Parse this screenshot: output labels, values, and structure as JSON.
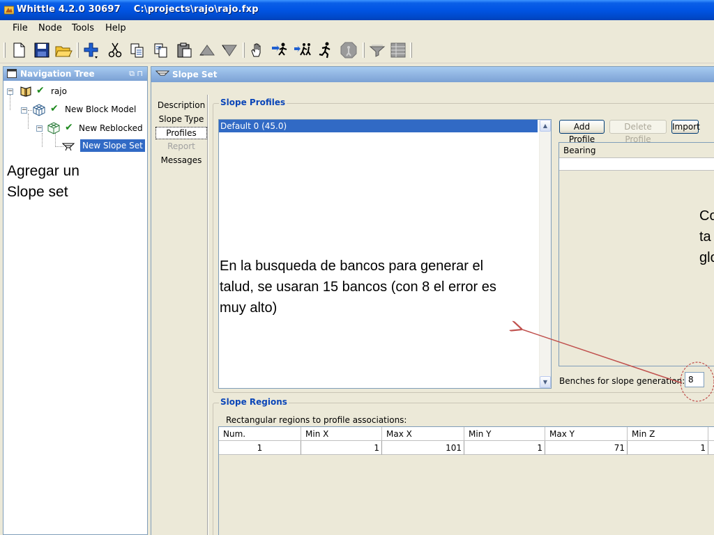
{
  "window": {
    "title": "Whittle 4.2.0 30697    C:\\projects\\rajo\\rajo.fxp"
  },
  "menu": [
    "File",
    "Node",
    "Tools",
    "Help"
  ],
  "toolbar": {
    "buttons": [
      "new-file-icon",
      "save-icon",
      "open-folder-icon",
      "add-node-icon",
      "cut-icon",
      "copy-icon",
      "paste-icon",
      "paste-special-icon",
      "pit-shell-icon",
      "inverted-pit-icon",
      "hand-pan-icon",
      "run-forward-icon",
      "run-multiple-icon",
      "runner-icon",
      "stop-icon",
      "filter-icon",
      "report-table-icon"
    ]
  },
  "nav": {
    "title": "Navigation Tree",
    "controls": "⧉ ⊓",
    "tree": [
      {
        "label": "rajo",
        "level": 0
      },
      {
        "label": "New Block Model",
        "level": 1
      },
      {
        "label": "New Reblocked",
        "level": 2
      },
      {
        "label": "New Slope Set",
        "level": 3,
        "selected": true
      }
    ],
    "annotation_line1": "Agregar un",
    "annotation_line2": "Slope set"
  },
  "slope_set": {
    "title": "Slope Set",
    "tabs": [
      {
        "label": "Description",
        "state": "normal"
      },
      {
        "label": "Slope Type",
        "state": "normal"
      },
      {
        "label": "Profiles",
        "state": "active"
      },
      {
        "label": "Report",
        "state": "disabled"
      },
      {
        "label": "Messages",
        "state": "normal"
      }
    ],
    "profiles_group_title": "Slope Profiles",
    "profiles_list": [
      "Default 0 (45.0)"
    ],
    "buttons": {
      "add": "Add Profile",
      "delete": "Delete Profile",
      "import": "Import"
    },
    "bearing_header": "Bearing",
    "benches_label": "Benches for slope generation:",
    "benches_value": "8",
    "annotation_center_l1": "En la busqueda de bancos para generar el",
    "annotation_center_l2": "talud, se usaran 15 bancos (con 8 el error es",
    "annotation_center_l3": "muy alto)",
    "annotation_right_l1": "Co",
    "annotation_right_l2": "ta",
    "annotation_right_l3": "glo",
    "regions_group_title": "Slope Regions",
    "regions_caption": "Rectangular regions to profile associations:",
    "regions_columns": [
      "Num.",
      "Min X",
      "Max X",
      "Min Y",
      "Max Y",
      "Min Z"
    ],
    "regions_rows": [
      [
        "1",
        "1",
        "101",
        "1",
        "71",
        "1"
      ]
    ]
  }
}
